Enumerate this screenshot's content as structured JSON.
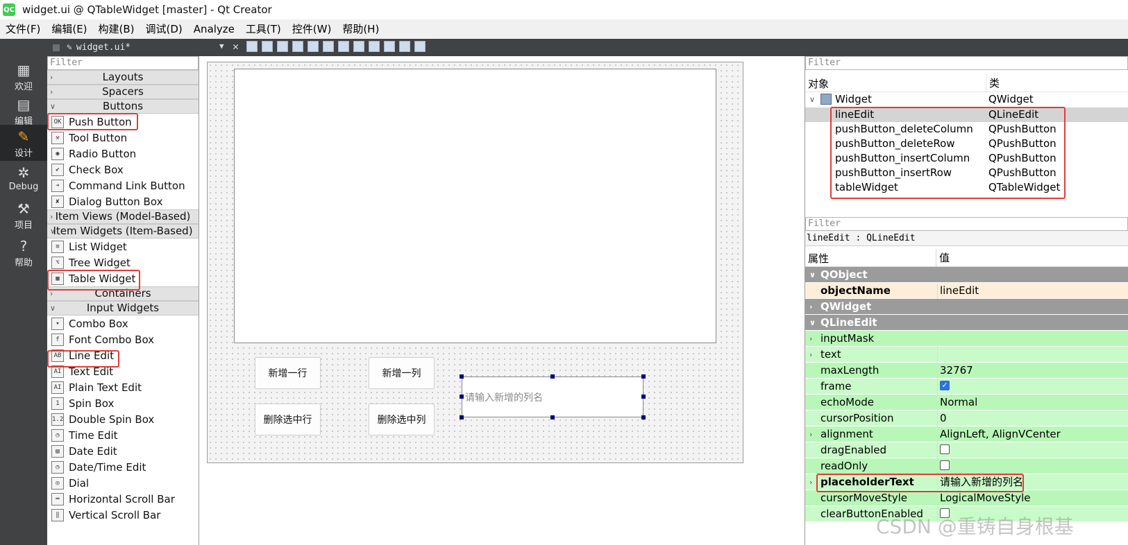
{
  "window": {
    "title": "widget.ui @ QTableWidget [master] - Qt Creator",
    "app_icon": "QC"
  },
  "menu": [
    "文件(F)",
    "编辑(E)",
    "构建(B)",
    "调试(D)",
    "Analyze",
    "工具(T)",
    "控件(W)",
    "帮助(H)"
  ],
  "modes": [
    {
      "label": "欢迎",
      "icon": "grid-icon"
    },
    {
      "label": "编辑",
      "icon": "document-icon"
    },
    {
      "label": "设计",
      "icon": "pencil-icon",
      "active": true
    },
    {
      "label": "Debug",
      "icon": "bug-icon"
    },
    {
      "label": "项目",
      "icon": "wrench-icon"
    },
    {
      "label": "帮助",
      "icon": "help-icon"
    }
  ],
  "editor": {
    "document": "widget.ui*"
  },
  "widgetbox": {
    "filter": "Filter",
    "entries": [
      {
        "type": "cat",
        "label": "Layouts",
        "open": false
      },
      {
        "type": "cat",
        "label": "Spacers",
        "open": false
      },
      {
        "type": "cat",
        "label": "Buttons",
        "open": true
      },
      {
        "type": "item",
        "label": "Push Button",
        "icon": "OK"
      },
      {
        "type": "item",
        "label": "Tool Button",
        "icon": "⚒"
      },
      {
        "type": "item",
        "label": "Radio Button",
        "icon": "◉"
      },
      {
        "type": "item",
        "label": "Check Box",
        "icon": "✔"
      },
      {
        "type": "item",
        "label": "Command Link Button",
        "icon": "➔"
      },
      {
        "type": "item",
        "label": "Dialog Button Box",
        "icon": "✘"
      },
      {
        "type": "cat",
        "label": "Item Views (Model-Based)",
        "open": false
      },
      {
        "type": "cat",
        "label": "Item Widgets (Item-Based)",
        "open": true
      },
      {
        "type": "item",
        "label": "List Widget",
        "icon": "≡"
      },
      {
        "type": "item",
        "label": "Tree Widget",
        "icon": "⌥"
      },
      {
        "type": "item",
        "label": "Table Widget",
        "icon": "▦"
      },
      {
        "type": "cat",
        "label": "Containers",
        "open": false
      },
      {
        "type": "cat",
        "label": "Input Widgets",
        "open": true
      },
      {
        "type": "item",
        "label": "Combo Box",
        "icon": "▾"
      },
      {
        "type": "item",
        "label": "Font Combo Box",
        "icon": "f"
      },
      {
        "type": "item",
        "label": "Line Edit",
        "icon": "AB"
      },
      {
        "type": "item",
        "label": "Text Edit",
        "icon": "AI"
      },
      {
        "type": "item",
        "label": "Plain Text Edit",
        "icon": "AI"
      },
      {
        "type": "item",
        "label": "Spin Box",
        "icon": "1"
      },
      {
        "type": "item",
        "label": "Double Spin Box",
        "icon": "1.2"
      },
      {
        "type": "item",
        "label": "Time Edit",
        "icon": "◷"
      },
      {
        "type": "item",
        "label": "Date Edit",
        "icon": "▤"
      },
      {
        "type": "item",
        "label": "Date/Time Edit",
        "icon": "◷"
      },
      {
        "type": "item",
        "label": "Dial",
        "icon": "◎"
      },
      {
        "type": "item",
        "label": "Horizontal Scroll Bar",
        "icon": "═"
      },
      {
        "type": "item",
        "label": "Vertical Scroll Bar",
        "icon": "‖"
      }
    ]
  },
  "form": {
    "buttons": {
      "insert_row": "新增一行",
      "insert_column": "新增一列",
      "delete_row": "删除选中行",
      "delete_column": "删除选中列"
    },
    "line_edit_placeholder": "请输入新增的列名"
  },
  "object_inspector": {
    "filter": "Filter",
    "headers": [
      "对象",
      "类"
    ],
    "root": {
      "name": "Widget",
      "class": "QWidget"
    },
    "children": [
      {
        "name": "lineEdit",
        "class": "QLineEdit",
        "selected": true
      },
      {
        "name": "pushButton_deleteColumn",
        "class": "QPushButton"
      },
      {
        "name": "pushButton_deleteRow",
        "class": "QPushButton"
      },
      {
        "name": "pushButton_insertColumn",
        "class": "QPushButton"
      },
      {
        "name": "pushButton_insertRow",
        "class": "QPushButton"
      },
      {
        "name": "tableWidget",
        "class": "QTableWidget"
      }
    ]
  },
  "property_editor": {
    "filter": "Filter",
    "subject": "lineEdit : QLineEdit",
    "headers": [
      "属性",
      "值"
    ],
    "rows": [
      {
        "kind": "group",
        "name": "QObject",
        "open": true
      },
      {
        "kind": "prop",
        "name": "objectName",
        "value": "lineEdit",
        "bold": true,
        "style": "orange"
      },
      {
        "kind": "group",
        "name": "QWidget",
        "open": false
      },
      {
        "kind": "group",
        "name": "QLineEdit",
        "open": true
      },
      {
        "kind": "prop",
        "name": "inputMask",
        "value": "",
        "expand": true
      },
      {
        "kind": "prop",
        "name": "text",
        "value": "",
        "expand": true
      },
      {
        "kind": "prop",
        "name": "maxLength",
        "value": "32767"
      },
      {
        "kind": "prop",
        "name": "frame",
        "checkbox": true,
        "checked": true
      },
      {
        "kind": "prop",
        "name": "echoMode",
        "value": "Normal"
      },
      {
        "kind": "prop",
        "name": "cursorPosition",
        "value": "0"
      },
      {
        "kind": "prop",
        "name": "alignment",
        "value": "AlignLeft, AlignVCenter",
        "expand": true
      },
      {
        "kind": "prop",
        "name": "dragEnabled",
        "checkbox": true,
        "checked": false
      },
      {
        "kind": "prop",
        "name": "readOnly",
        "checkbox": true,
        "checked": false
      },
      {
        "kind": "prop",
        "name": "placeholderText",
        "value": "请输入新增的列名",
        "bold": true,
        "expand": true
      },
      {
        "kind": "prop",
        "name": "cursorMoveStyle",
        "value": "LogicalMoveStyle"
      },
      {
        "kind": "prop",
        "name": "clearButtonEnabled",
        "checkbox": true,
        "checked": false
      }
    ]
  },
  "watermark": "CSDN @重铸自身根基",
  "colors": {
    "highlight": "#e23b3b",
    "property_green": "#b8f7b8",
    "group_grey": "#9b9b9b",
    "modebar": "#404244"
  }
}
